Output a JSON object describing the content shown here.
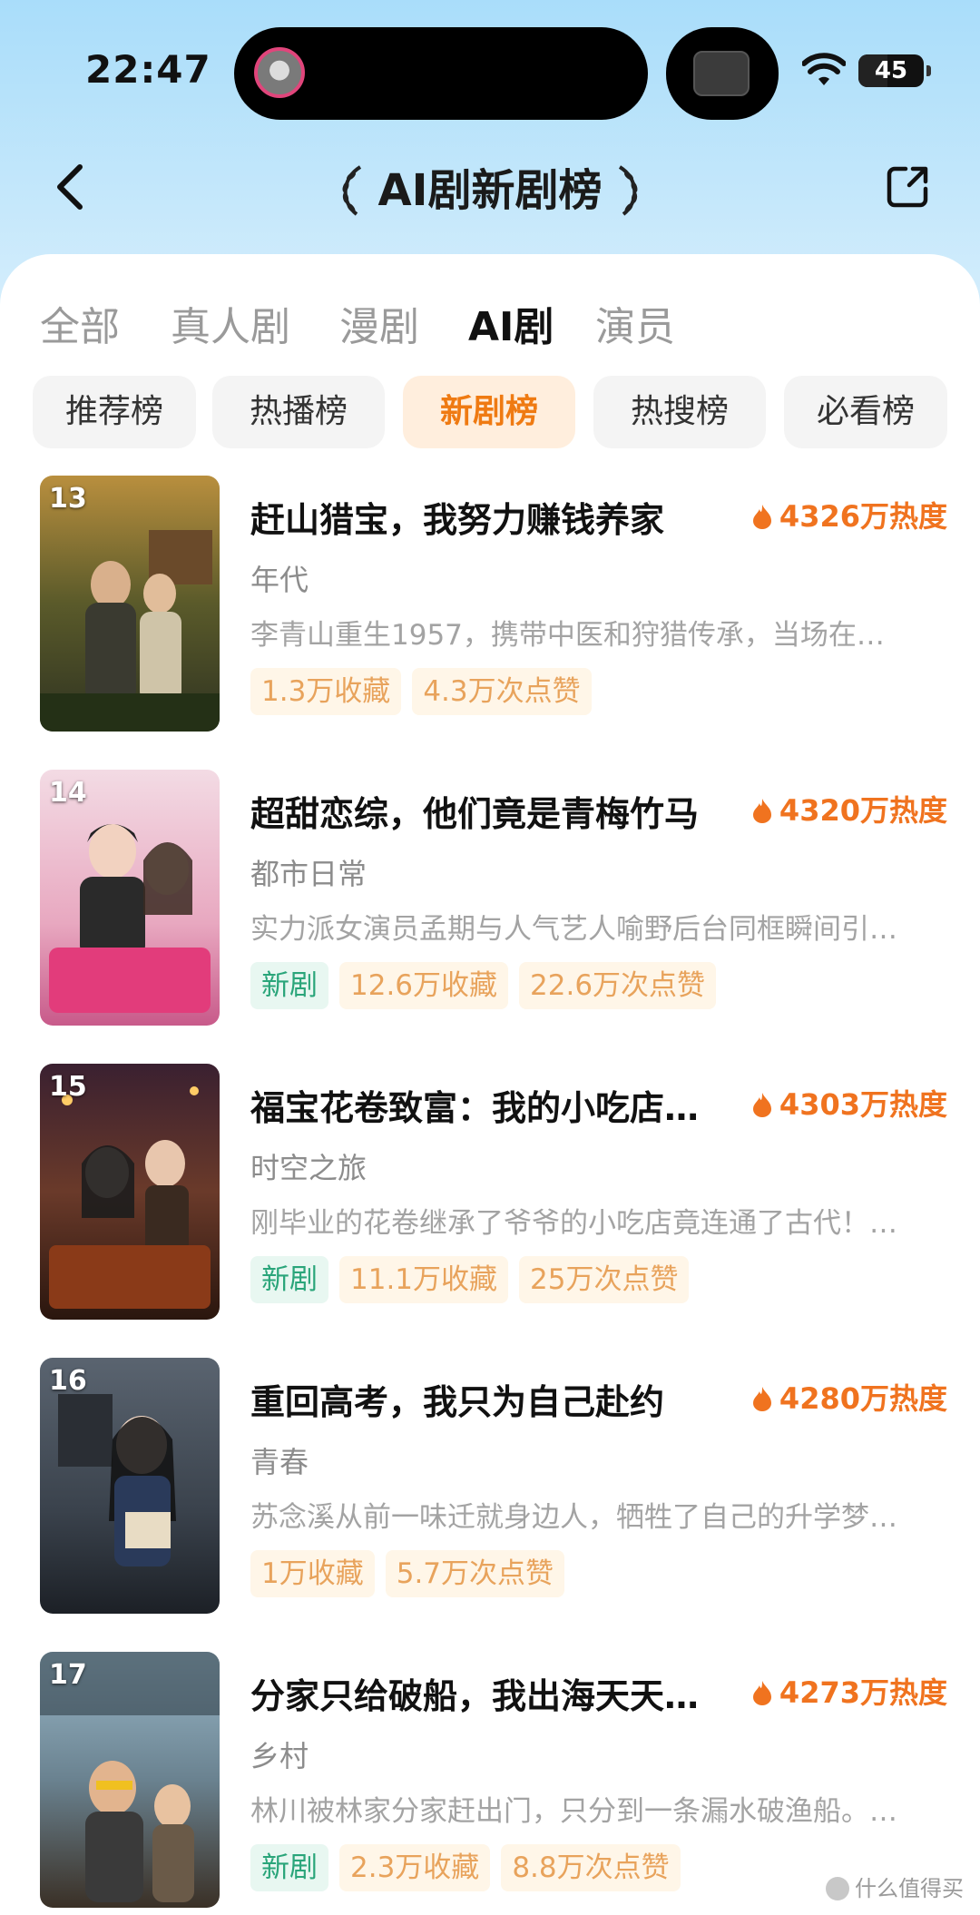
{
  "status_bar": {
    "time": "22:47",
    "battery": "45",
    "battery_level_percent": 45
  },
  "nav": {
    "title": "AI剧新剧榜",
    "back_icon": "chevron-left-icon",
    "share_icon": "share-icon"
  },
  "category_tabs": [
    {
      "label": "全部",
      "active": false
    },
    {
      "label": "真人剧",
      "active": false
    },
    {
      "label": "漫剧",
      "active": false
    },
    {
      "label": "AI剧",
      "active": true
    },
    {
      "label": "演员",
      "active": false
    }
  ],
  "rank_tabs": [
    {
      "label": "推荐榜",
      "active": false
    },
    {
      "label": "热播榜",
      "active": false
    },
    {
      "label": "新剧榜",
      "active": true
    },
    {
      "label": "热搜榜",
      "active": false
    },
    {
      "label": "必看榜",
      "active": false
    }
  ],
  "colors": {
    "accent": "#ef7a12",
    "heat": "#f0731f",
    "new_tag": "#2aa57a",
    "stat_tag": "#e8a35c"
  },
  "items": [
    {
      "rank": "13",
      "title": "赶山猎宝，我努力赚钱养家",
      "heat": "4326万热度",
      "genre": "年代",
      "desc": "李青山重生1957，携带中医和狩猎传承，当场在…",
      "new_tag": "",
      "tags": [
        "1.3万收藏",
        "4.3万次点赞"
      ]
    },
    {
      "rank": "14",
      "title": "超甜恋综，他们竟是青梅竹马",
      "heat": "4320万热度",
      "genre": "都市日常",
      "desc": "实力派女演员孟期与人气艺人喻野后台同框瞬间引…",
      "new_tag": "新剧",
      "tags": [
        "12.6万收藏",
        "22.6万次点赞"
      ]
    },
    {
      "rank": "15",
      "title": "福宝花卷致富：我的小吃店…",
      "heat": "4303万热度",
      "genre": "时空之旅",
      "desc": "刚毕业的花卷继承了爷爷的小吃店竟连通了古代！…",
      "new_tag": "新剧",
      "tags": [
        "11.1万收藏",
        "25万次点赞"
      ]
    },
    {
      "rank": "16",
      "title": "重回高考，我只为自己赴约",
      "heat": "4280万热度",
      "genre": "青春",
      "desc": "苏念溪从前一味迁就身边人，牺牲了自己的升学梦…",
      "new_tag": "",
      "tags": [
        "1万收藏",
        "5.7万次点赞"
      ]
    },
    {
      "rank": "17",
      "title": "分家只给破船，我出海天天…",
      "heat": "4273万热度",
      "genre": "乡村",
      "desc": "林川被林家分家赶出门，只分到一条漏水破渔船。…",
      "new_tag": "新剧",
      "tags": [
        "2.3万收藏",
        "8.8万次点赞"
      ]
    }
  ],
  "watermark": "什么值得买"
}
